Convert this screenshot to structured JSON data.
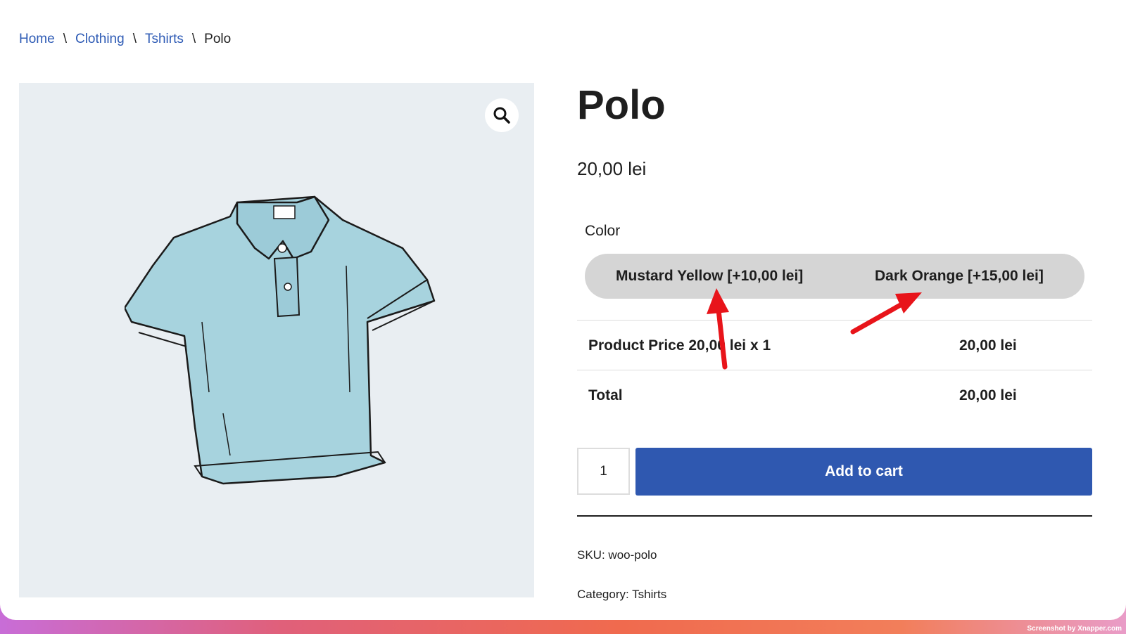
{
  "breadcrumb": {
    "items": [
      "Home",
      "Clothing",
      "Tshirts"
    ],
    "current": "Polo",
    "separator": "\\"
  },
  "product": {
    "title": "Polo",
    "price": "20,00 lei",
    "image_icon": "polo-shirt-illustration",
    "zoom_icon": "magnifier-icon"
  },
  "variations": {
    "label": "Color",
    "options": [
      "Mustard Yellow [+10,00 lei]",
      "Dark Orange [+15,00 lei]"
    ]
  },
  "price_summary": {
    "rows": [
      {
        "label": "Product Price 20,00 lei x 1",
        "value": "20,00 lei"
      },
      {
        "label": "Total",
        "value": "20,00 lei"
      }
    ]
  },
  "cart": {
    "quantity": "1",
    "add_label": "Add to cart"
  },
  "meta": {
    "sku_label": "SKU:",
    "sku_value": "woo-polo",
    "category_label": "Category:",
    "category_value": "Tshirts"
  },
  "annotations": {
    "arrow_color": "#e8141a"
  },
  "colors": {
    "link": "#2e5bb5",
    "button": "#2f58b0",
    "swatch_bg": "#d5d5d5",
    "gallery_bg": "#e9eef2"
  },
  "watermark": "Screenshot by Xnapper.com"
}
